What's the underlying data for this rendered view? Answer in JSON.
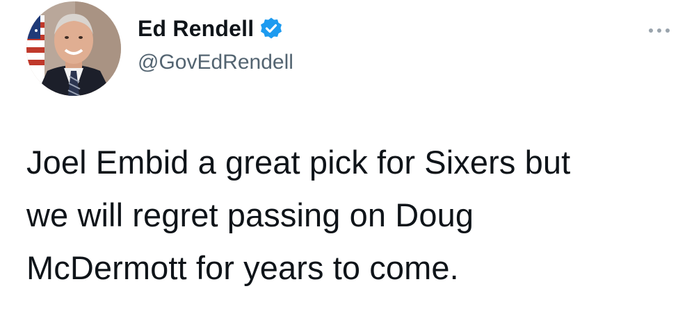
{
  "tweet": {
    "author": {
      "display_name": "Ed Rendell",
      "handle": "@GovEdRendell",
      "verified_icon": "verified-badge-icon",
      "avatar": "profile-photo"
    },
    "more_icon": "ellipsis-icon",
    "text_lines": [
      "Joel Embid a great pick for Sixers but",
      "we will regret passing on Doug",
      "McDermott for years to come."
    ]
  },
  "colors": {
    "text": "#0f1419",
    "secondary": "#536471",
    "verified": "#1d9bf0",
    "background": "#ffffff"
  }
}
